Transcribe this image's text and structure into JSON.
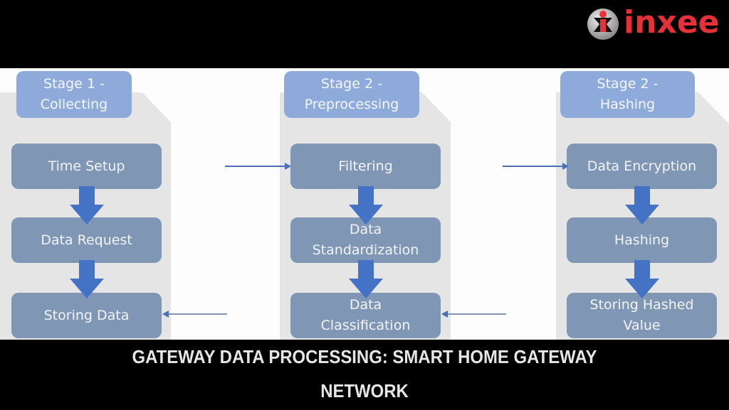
{
  "brand": {
    "name": "inxee",
    "logo_icon": "inxee-logo-icon",
    "color": "#e8303a"
  },
  "diagram": {
    "stages": [
      {
        "header": [
          "Stage 1 -",
          "Collecting"
        ],
        "steps": [
          [
            "Time Setup"
          ],
          [
            "Data Request"
          ],
          [
            "Storing Data"
          ]
        ]
      },
      {
        "header": [
          "Stage 2 -",
          "Preprocessing"
        ],
        "steps": [
          [
            "Filtering"
          ],
          [
            "Data",
            "Standardization"
          ],
          [
            "Data",
            "Classification"
          ]
        ]
      },
      {
        "header": [
          "Stage 2 -",
          "Hashing"
        ],
        "steps": [
          [
            "Data Encryption"
          ],
          [
            "Hashing"
          ],
          [
            "Storing Hashed",
            "Value"
          ]
        ]
      }
    ],
    "colors": {
      "panel": "#e5e5e5",
      "header": "#8eaadb",
      "step": "#7f96b5",
      "arrow": "#4472c4",
      "connector": "#4a6fb5"
    }
  },
  "caption": {
    "line1": "GATEWAY DATA PROCESSING: SMART HOME GATEWAY",
    "line2": "NETWORK"
  }
}
